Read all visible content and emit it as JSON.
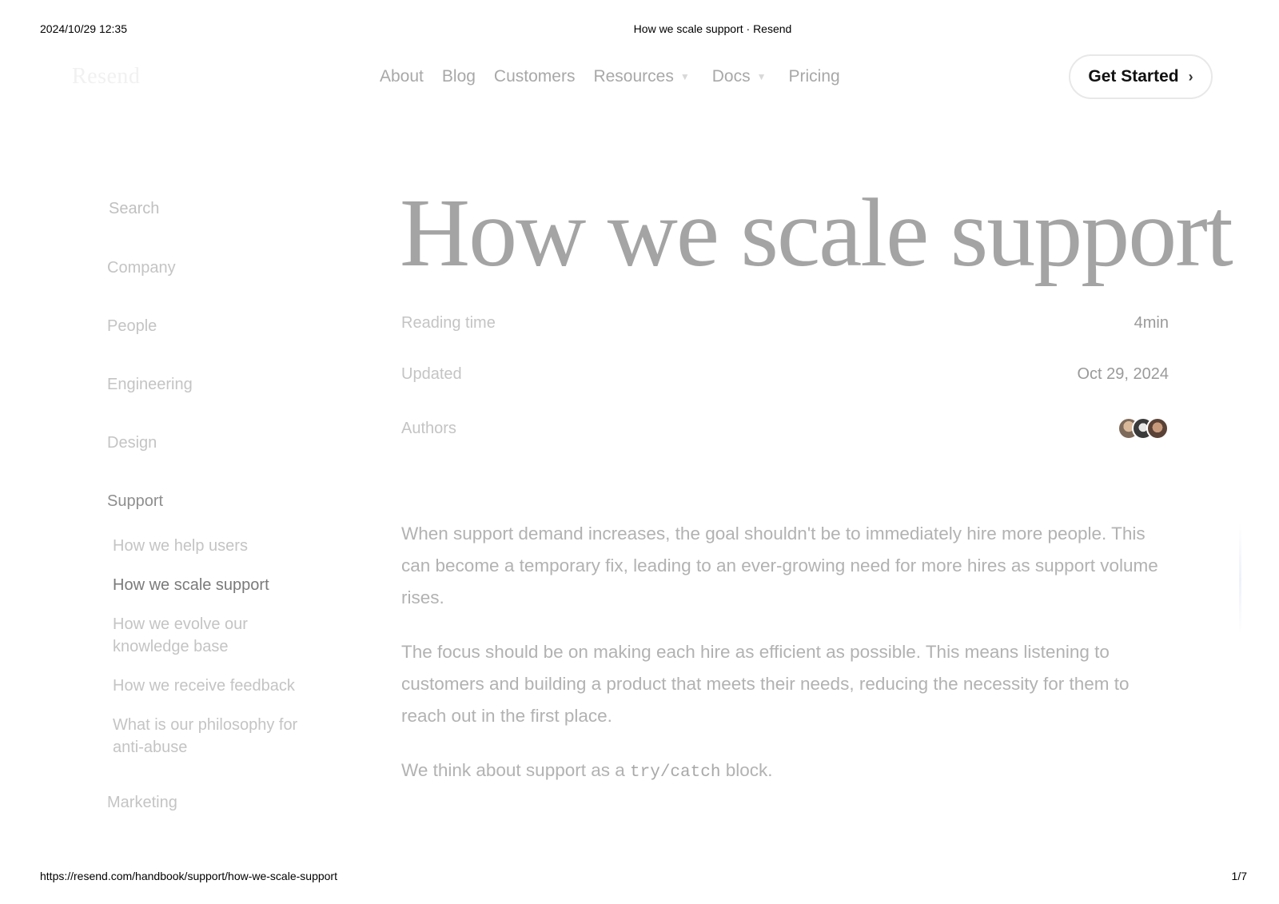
{
  "print": {
    "date": "2024/10/29 12:35",
    "doc_title": "How we scale support · Resend",
    "url": "https://resend.com/handbook/support/how-we-scale-support",
    "page": "1/7"
  },
  "header": {
    "logo": "Resend",
    "nav": [
      {
        "label": "About"
      },
      {
        "label": "Blog"
      },
      {
        "label": "Customers"
      },
      {
        "label": "Resources"
      },
      {
        "label": "Docs"
      },
      {
        "label": "Pricing"
      }
    ],
    "cta_label": "Get Started"
  },
  "sidebar": {
    "search_label": "Search",
    "categories": [
      "Company",
      "People",
      "Engineering",
      "Design"
    ],
    "active_category": "Support",
    "subitems": [
      "How we help users",
      "How we scale support",
      "How we evolve our knowledge base",
      "How we receive feedback",
      "What is our philosophy for anti-abuse"
    ],
    "after_category": "Marketing"
  },
  "article": {
    "title": "How we scale support",
    "meta": {
      "reading_label": "Reading time",
      "reading_value": "4min",
      "updated_label": "Updated",
      "updated_value": "Oct 29, 2024",
      "authors_label": "Authors"
    },
    "paragraphs": [
      "When support demand increases, the goal shouldn't be to immediately hire more people. This can become a temporary fix, leading to an ever-growing need for more hires as support volume rises.",
      "The focus should be on making each hire as efficient as possible. This means listening to customers and building a product that meets their needs, reducing the necessity for them to reach out in the first place."
    ],
    "p3_before": "We think about support as a ",
    "p3_code": "try/catch",
    "p3_after": " block."
  },
  "icons": {
    "chevron_down": "chevron-down-icon",
    "chevron_right": "chevron-right-icon"
  }
}
